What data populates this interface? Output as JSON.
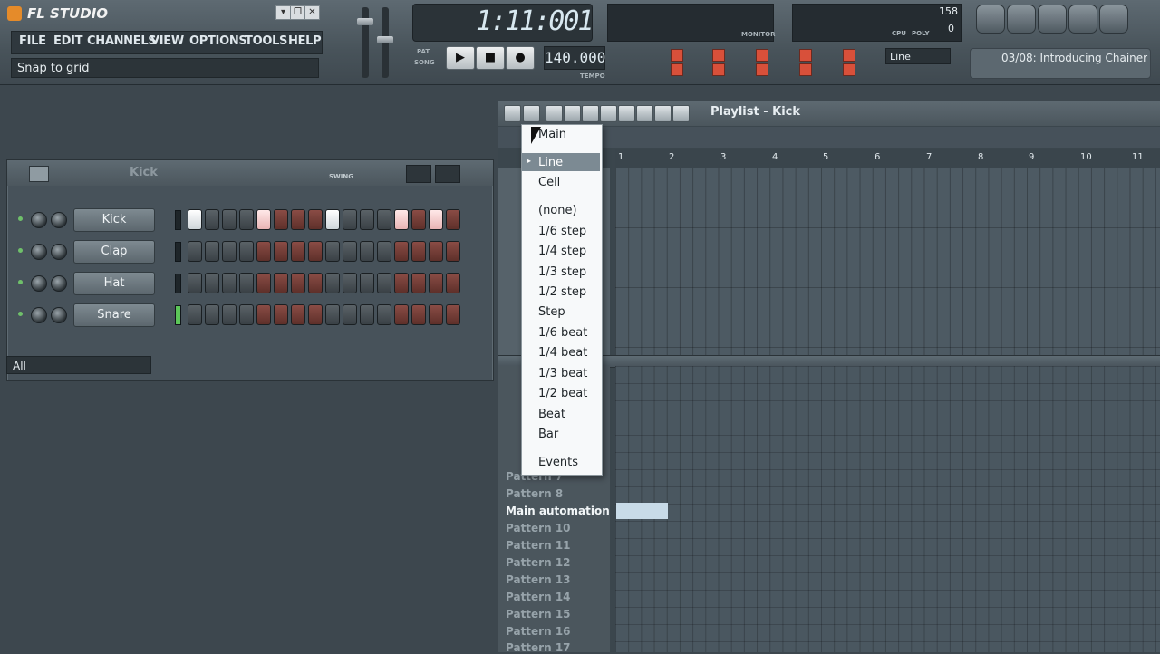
{
  "app": {
    "title": "FL STUDIO"
  },
  "menu": {
    "items": [
      "FILE",
      "EDIT",
      "CHANNELS",
      "VIEW",
      "OPTIONS",
      "TOOLS",
      "HELP"
    ]
  },
  "hint_bar": {
    "text": "Snap to grid"
  },
  "transport": {
    "time": "1:11:001",
    "tempo": "140.000",
    "pat_label": "PAT",
    "song_label": "SONG",
    "tempo_label": "TEMPO"
  },
  "top_right": {
    "snap_value": "Line",
    "hint_title": "03/08: Introducing Chainer",
    "cpu_label": "CPU",
    "poly_label": "POLY",
    "cpu_value": "158",
    "poly_value": "0",
    "monitor_label": "MONITOR"
  },
  "step_sequencer": {
    "pattern_name": "Kick",
    "swing_label": "SWING",
    "filter_label": "All",
    "channels": [
      {
        "name": "Kick",
        "steps": [
          1,
          0,
          0,
          0,
          1,
          0,
          0,
          0,
          1,
          0,
          0,
          0,
          1,
          0,
          1,
          0
        ]
      },
      {
        "name": "Clap",
        "steps": [
          0,
          0,
          0,
          0,
          0,
          0,
          0,
          0,
          0,
          0,
          0,
          0,
          0,
          0,
          0,
          0
        ]
      },
      {
        "name": "Hat",
        "steps": [
          0,
          0,
          0,
          0,
          0,
          0,
          0,
          0,
          0,
          0,
          0,
          0,
          0,
          0,
          0,
          0
        ]
      },
      {
        "name": "Snare",
        "steps": [
          0,
          0,
          0,
          0,
          0,
          0,
          0,
          0,
          0,
          0,
          0,
          0,
          0,
          0,
          0,
          0
        ]
      }
    ]
  },
  "playlist": {
    "title": "Playlist - Kick",
    "ruler": [
      "1",
      "2",
      "3",
      "4",
      "5",
      "6",
      "7",
      "8",
      "9",
      "10",
      "11"
    ],
    "patterns": [
      {
        "name": "Pattern 7",
        "active": false
      },
      {
        "name": "Pattern 8",
        "active": false
      },
      {
        "name": "Main automation",
        "active": true
      },
      {
        "name": "Pattern 10",
        "active": false
      },
      {
        "name": "Pattern 11",
        "active": false
      },
      {
        "name": "Pattern 12",
        "active": false
      },
      {
        "name": "Pattern 13",
        "active": false
      },
      {
        "name": "Pattern 14",
        "active": false
      },
      {
        "name": "Pattern 15",
        "active": false
      },
      {
        "name": "Pattern 16",
        "active": false
      },
      {
        "name": "Pattern 17",
        "active": false
      }
    ]
  },
  "snap_menu": {
    "items": [
      "Main",
      "Line",
      "Cell",
      "(none)",
      "1/6 step",
      "1/4 step",
      "1/3 step",
      "1/2 step",
      "Step",
      "1/6 beat",
      "1/4 beat",
      "1/3 beat",
      "1/2 beat",
      "Beat",
      "Bar",
      "Events"
    ],
    "selected": "Line"
  }
}
